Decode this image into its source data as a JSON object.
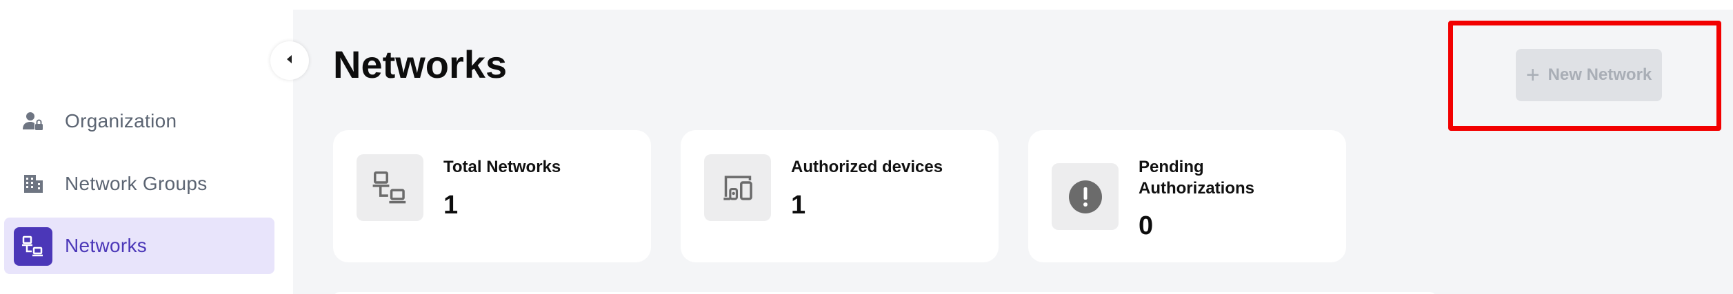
{
  "sidebar": {
    "items": [
      {
        "label": "Organization",
        "icon": "user-lock-icon",
        "active": false
      },
      {
        "label": "Network Groups",
        "icon": "building-icon",
        "active": false
      },
      {
        "label": "Networks",
        "icon": "network-icon",
        "active": true
      }
    ]
  },
  "main": {
    "title": "Networks",
    "new_network_label": "New Network",
    "stats": [
      {
        "label": "Total Networks",
        "value": "1",
        "icon": "network-icon"
      },
      {
        "label": "Authorized devices",
        "value": "1",
        "icon": "devices-icon"
      },
      {
        "label": "Pending Authorizations",
        "value": "0",
        "icon": "alert-icon"
      }
    ]
  },
  "colors": {
    "accent": "#4b37b8",
    "accent_bg": "#e8e4fb",
    "highlight": "#f20000",
    "background": "#f4f5f7"
  }
}
